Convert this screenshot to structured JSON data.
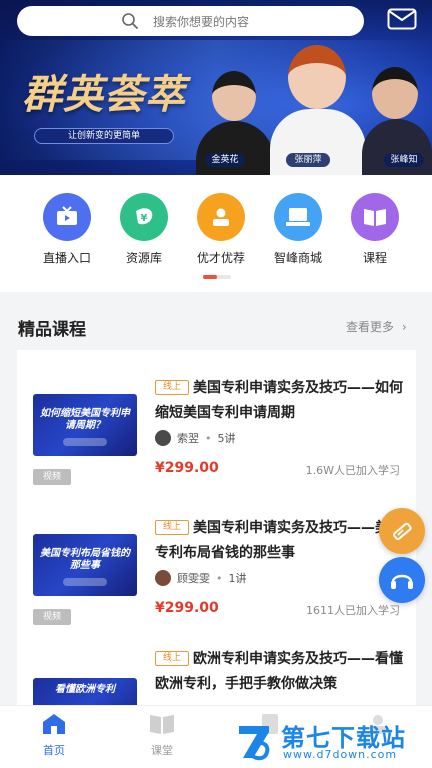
{
  "search": {
    "placeholder": "搜索你想要的内容"
  },
  "banner": {
    "title": "群英荟萃",
    "slogan": "让创新变的更简单",
    "people": [
      "金英花",
      "张丽萍",
      "张峰知"
    ]
  },
  "nav": [
    {
      "label": "直播入口",
      "icon": "tv-icon",
      "color": "#4e6ff0"
    },
    {
      "label": "资源库",
      "icon": "yuan-icon",
      "color": "#2fc08a"
    },
    {
      "label": "优才优荐",
      "icon": "person-icon",
      "color": "#f7a21f"
    },
    {
      "label": "智峰商城",
      "icon": "laptop-icon",
      "color": "#45a3f5"
    },
    {
      "label": "课程",
      "icon": "book-icon",
      "color": "#a068e8"
    }
  ],
  "section": {
    "title": "精品课程",
    "more": "查看更多"
  },
  "courses": [
    {
      "badge": "线上",
      "title": "美国专利申请实务及技巧——如何缩短美国专利申请周期",
      "thumb_text": "如何缩短美国专利申请周期？",
      "type": "视频",
      "author": "索翌",
      "lessons": "5讲",
      "price": "¥299.00",
      "learners": "1.6W人已加入学习"
    },
    {
      "badge": "线上",
      "title": "美国专利申请实务及技巧——美国专利布局省钱的那些事",
      "thumb_text": "美国专利布局省钱的那些事",
      "type": "视频",
      "author": "顾雯雯",
      "lessons": "1讲",
      "price": "¥299.00",
      "learners": "1611人已加入学习"
    },
    {
      "badge": "线上",
      "title": "欧洲专利申请实务及技巧——看懂欧洲专利，手把手教你做决策",
      "thumb_text": "看懂欧洲专利",
      "type": "",
      "author": "",
      "lessons": "",
      "price": "",
      "learners": ""
    }
  ],
  "tabbar": [
    {
      "label": "首页",
      "active": true
    },
    {
      "label": "课堂",
      "active": false
    }
  ],
  "watermark": {
    "title": "第七下载站",
    "url": "www.d7down.com"
  },
  "colors": {
    "accent": "#e23a2b",
    "brand_blue": "#1a3aa8",
    "badge_orange": "#e8891f"
  }
}
